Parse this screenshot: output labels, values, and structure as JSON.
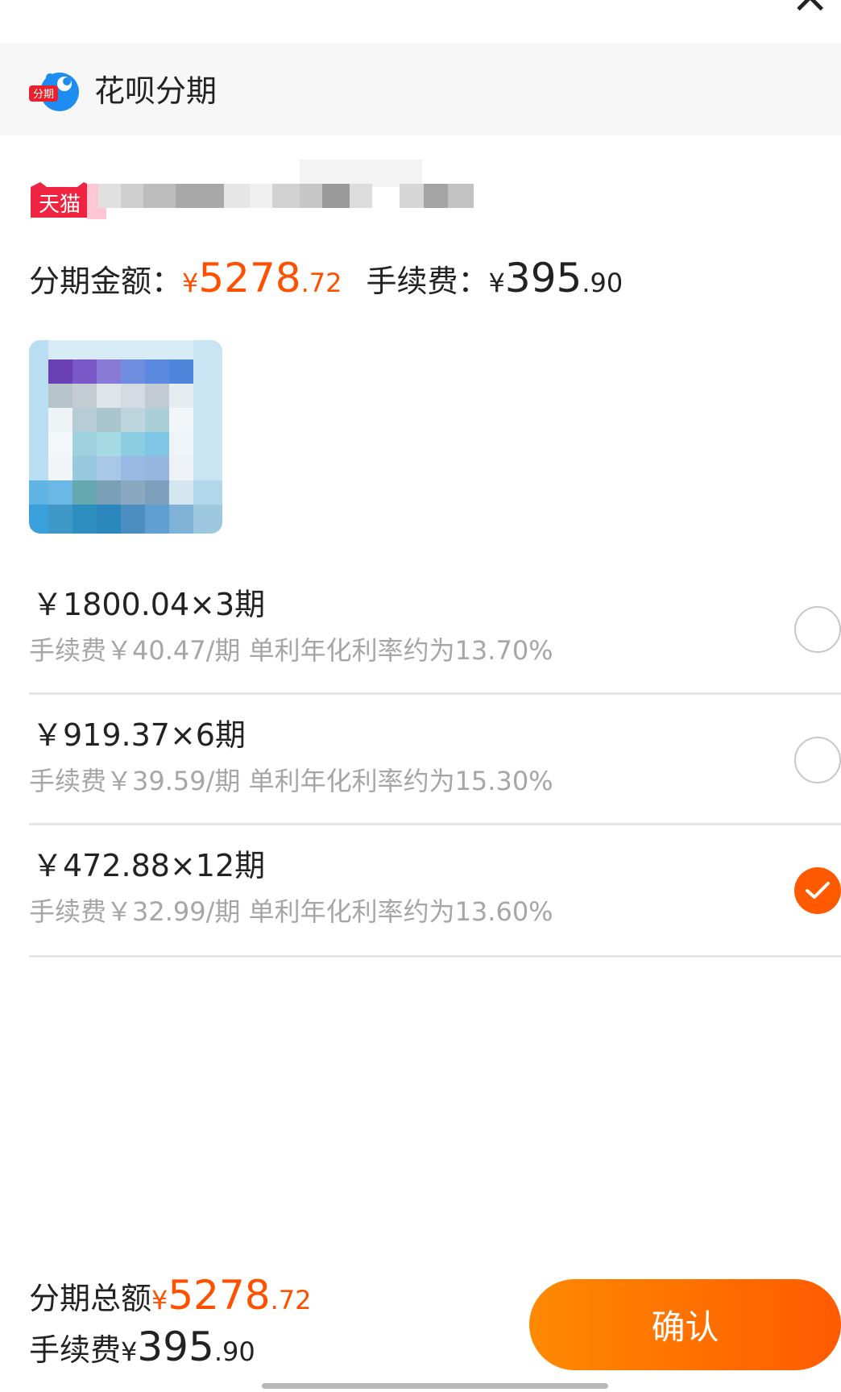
{
  "header": {
    "title": "花呗分期",
    "logo_text": "分期"
  },
  "product": {
    "store_badge": "天猫"
  },
  "amounts": {
    "principal_label": "分期金额：",
    "principal_currency": "¥",
    "principal_int": "5278",
    "principal_dec": ".72",
    "fee_label": "手续费：",
    "fee_currency": "¥",
    "fee_int": "395",
    "fee_dec": ".90"
  },
  "plans": [
    {
      "main": "￥1800.04×3期",
      "detail": "手续费￥40.47/期 单利年化利率约为13.70%",
      "selected": false
    },
    {
      "main": "￥919.37×6期",
      "detail": "手续费￥39.59/期 单利年化利率约为15.30%",
      "selected": false
    },
    {
      "main": "￥472.88×12期",
      "detail": "手续费￥32.99/期 单利年化利率约为13.60%",
      "selected": true
    }
  ],
  "footer": {
    "total_label": "分期总额",
    "total_currency": "¥",
    "total_int": "5278",
    "total_dec": ".72",
    "fee_label": "手续费",
    "fee_currency": "¥",
    "fee_int": "395",
    "fee_dec": ".90",
    "confirm_label": "确认"
  },
  "colors": {
    "accent": "#ff5000",
    "button_start": "#ff8a00",
    "button_end": "#ff5a00",
    "muted": "#a6a6a6"
  }
}
